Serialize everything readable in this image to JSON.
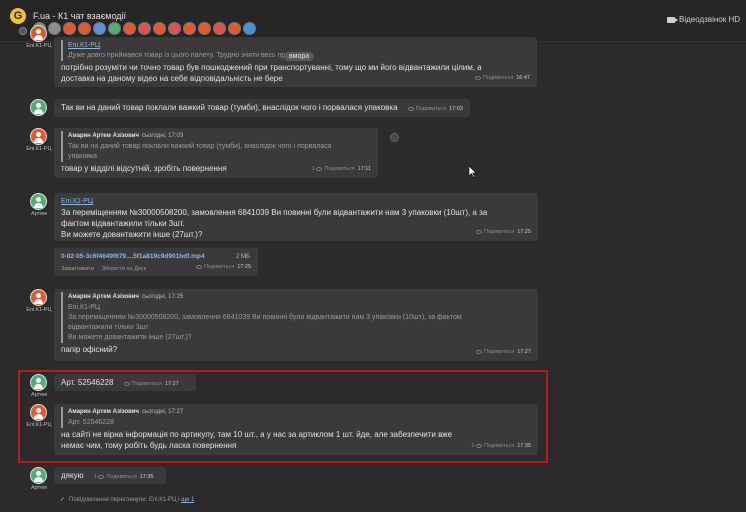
{
  "header": {
    "title": "F.ua - К1 чат взаємодії",
    "video_label": "Відеодзвінок HD",
    "members": [
      "#4caf76",
      "#8e8e8e",
      "#e25a2c",
      "#e25a2c",
      "#5e8fd8",
      "#4caf76",
      "#e25a2c",
      "#d9534f",
      "#e25a2c",
      "#d9534f",
      "#e25a2c",
      "#e25a2c",
      "#d9534f",
      "#e25a2c",
      "#4a90d9"
    ]
  },
  "messages": {
    "m1": {
      "author_label": "Епі.К1-РЦ",
      "quote_author": "Епі.К1-РЦ",
      "quote_text": "Дуже довго приймався товар із цього палету. Трудно зняти весь про",
      "tag": "вмора",
      "text": "потрібно розуміти чи точно товар був пошкоджений при транспортуванні, тому що ми його відвантажили цілим, а доставка на даному відео на себе відповідальність не бере",
      "status": "Подивиться",
      "time": "16:47"
    },
    "m2": {
      "author_label": "Артем",
      "text": "Так ви на даний товар поклали важкий товар (тумби), внаслідок чого і порвалася упаковка",
      "status": "Подивиться",
      "time": "17:03"
    },
    "m3": {
      "author_label": "Епі.К1-РЦ",
      "quote_author": "Амарян Артем Азізович",
      "quote_when": "сьогодні, 17:03",
      "quote_text": "Так ви на даний товар поклали важкий товар (тумби), внаслідок чого і порвалася упаковка",
      "text": "товар у відділі відсутній, зробіть повернення",
      "count": "1",
      "status": "Подивиться",
      "time": "17:11"
    },
    "m4": {
      "author_label": "Артем",
      "link": "Епі.К1-РЦ",
      "text": "За переміщенням №30000508200, замовлення 6841039 Ви повинні були відвантажити нам 3 упаковки (10шт), а за фактом відвантажили тільки 3шт.",
      "text2": "Ви можете довантажити інше (27шт.)?",
      "status": "Подивиться",
      "time": "17:25"
    },
    "file": {
      "name": "0-02-05-3c6f4649f679....5f1a819c9d901bdf.mp4",
      "size": "2 МБ",
      "download": "Завантажити",
      "save": "Зберегти на Диск",
      "status": "Подивиться",
      "time": "17:25"
    },
    "m5": {
      "author_label": "Епі.К1-РЦ",
      "quote_author": "Амарян Артем Азізович",
      "quote_when": "сьогодні, 17:25",
      "quote_link": "Епі.К1-РЦ",
      "quote_text": "За переміщенням №30000508200, замовлення 6841039 Ви повинні були відвантажити нам 3 упаковки (10шт), за фактом відвантажили тільки 3шт",
      "quote_text2": "Ви можете довантажити інше (27шт.)?",
      "text": "папір офісний?",
      "status": "Подивиться",
      "time": "17:27"
    },
    "m6": {
      "author_label": "Артем",
      "text": "Арт. 52546228",
      "status": "Подивиться",
      "time": "17:27"
    },
    "m7": {
      "author_label": "Епі.К1-РЦ",
      "quote_author": "Амарян Артем Азізович",
      "quote_when": "сьогодні, 17:27",
      "quote_text": "Арт. 52546228",
      "text": "на сайті не вірна інформація по артикулу, там 10 шт., а у нас за артиклом 1 шт. йде, але забезпечити вже немає чим, тому робіть будь ласка повернення",
      "count": "1",
      "status": "Подивиться",
      "time": "17:35"
    },
    "m8": {
      "author_label": "Артем",
      "text": "дякую",
      "count": "1",
      "status": "Подивиться",
      "time": "17:35"
    }
  },
  "seen": {
    "text": "Повідомлення переглянули: Епі.К1-РЦ і",
    "more": "ще 1"
  }
}
